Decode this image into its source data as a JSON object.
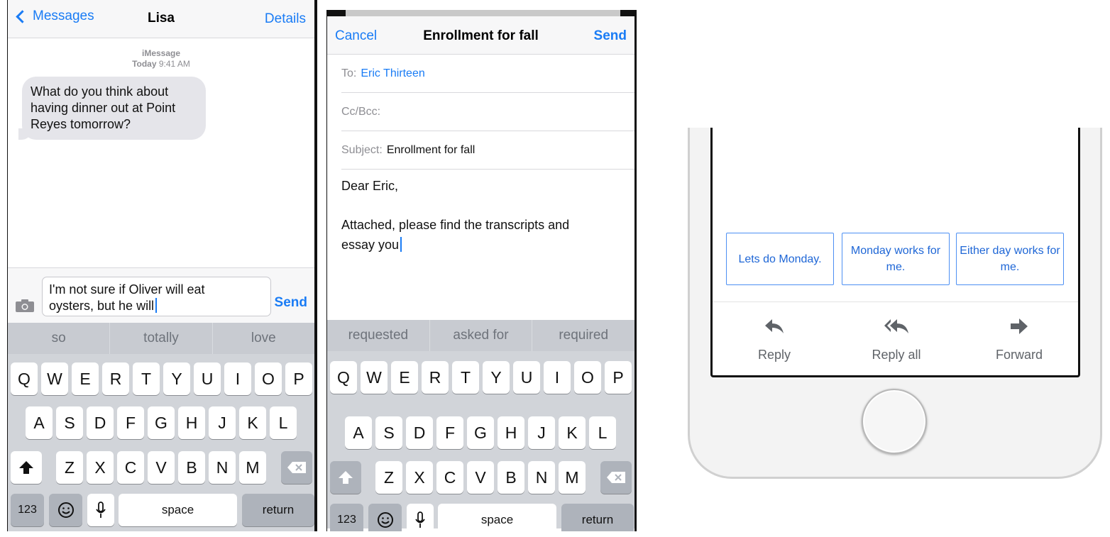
{
  "messages": {
    "nav": {
      "back_label": "Messages",
      "title": "Lisa",
      "details_label": "Details"
    },
    "meta": {
      "service": "iMessage",
      "day": "Today",
      "time": "9:41 AM"
    },
    "incoming_message": "What do you think about having dinner out at Point Reyes tomorrow?",
    "compose": {
      "line1": "I'm not sure if Oliver will eat",
      "line2": "oysters, but he will",
      "send_label": "Send",
      "camera_icon": "camera-icon"
    },
    "suggestions": [
      "so",
      "totally",
      "love"
    ]
  },
  "mail": {
    "nav": {
      "cancel_label": "Cancel",
      "title": "Enrollment for fall",
      "send_label": "Send"
    },
    "to_label": "To:",
    "to_value": "Eric Thirteen",
    "cc_label": "Cc/Bcc:",
    "subject_label": "Subject:",
    "subject_value": "Enrollment for fall",
    "body_greeting": "Dear Eric,",
    "body_line1": "Attached, please find the transcripts and",
    "body_line2": "essay you",
    "suggestions": [
      "requested",
      "asked for",
      "required"
    ]
  },
  "keyboard": {
    "row1": [
      "Q",
      "W",
      "E",
      "R",
      "T",
      "Y",
      "U",
      "I",
      "O",
      "P"
    ],
    "row2": [
      "A",
      "S",
      "D",
      "F",
      "G",
      "H",
      "J",
      "K",
      "L"
    ],
    "row3": [
      "Z",
      "X",
      "C",
      "V",
      "B",
      "N",
      "M"
    ],
    "numbers_label": "123",
    "space_label": "space",
    "return_label": "return",
    "icons": [
      "shift-icon",
      "backspace-icon",
      "emoji-icon",
      "microphone-icon"
    ]
  },
  "smart_reply": {
    "chips": [
      "Lets do Monday.",
      "Monday works for me.",
      "Either day works for me."
    ],
    "actions": [
      {
        "label": "Reply",
        "icon": "reply-icon"
      },
      {
        "label": "Reply all",
        "icon": "reply-all-icon"
      },
      {
        "label": "Forward",
        "icon": "forward-icon"
      }
    ],
    "accent_color": "#1e66d6"
  },
  "colors": {
    "ios_blue": "#1a7cf5",
    "keyboard_bg": "#d1d4d9",
    "bubble_gray": "#e5e5ea"
  }
}
